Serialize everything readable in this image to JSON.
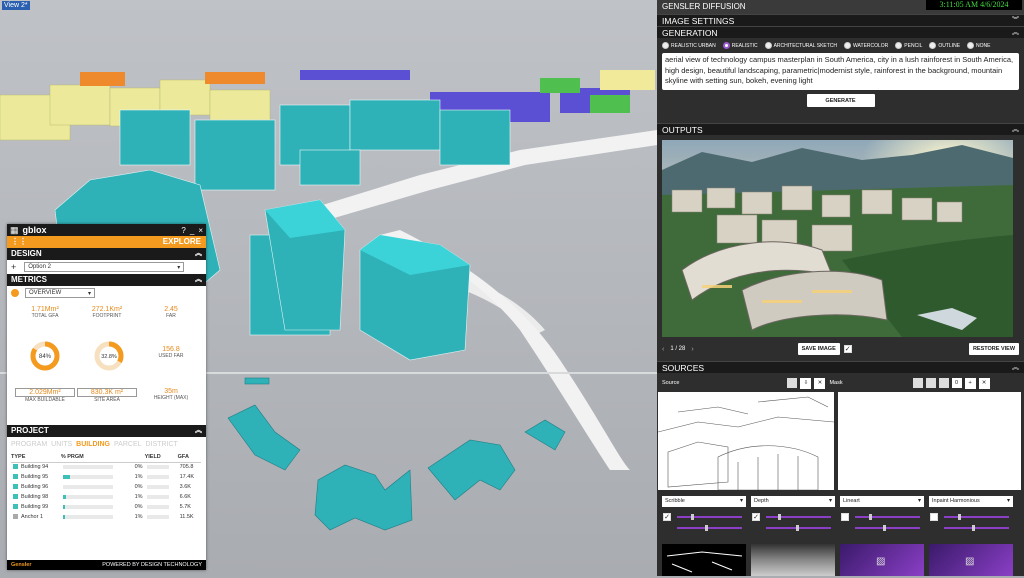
{
  "viewport": {
    "tab_label": "View 2*"
  },
  "gblox": {
    "logo": "gblox",
    "window_controls": [
      "?",
      "_",
      "×"
    ],
    "explore_label": "EXPLORE",
    "design_title": "DESIGN",
    "design_add": "+",
    "design_option": "Option 2",
    "metrics_title": "METRICS",
    "metrics_view": "OVERVIEW",
    "metrics": [
      {
        "value": "1.71Mm²",
        "label": "TOTAL GFA"
      },
      {
        "value": "272.1Km²",
        "label": "FOOTPRINT"
      },
      {
        "value": "2.45",
        "label": "FAR"
      },
      {
        "value": "84%",
        "label": ""
      },
      {
        "value": "32.8%",
        "label": ""
      },
      {
        "value": "156.8",
        "label": "USED FAR"
      },
      {
        "value": "2.029Mm²",
        "label": "MAX BUILDABLE"
      },
      {
        "value": "830.3K m²",
        "label": "SITE AREA"
      },
      {
        "value": "35m",
        "label": "HEIGHT (MAX)"
      }
    ],
    "donut1_pct": 84,
    "donut2_pct": 32.8,
    "project_title": "PROJECT",
    "project_tabs": [
      "PROGRAM",
      "UNITS",
      "BUILDING",
      "PARCEL",
      "DISTRICT"
    ],
    "project_active_tab": "BUILDING",
    "table_headers": [
      "TYPE",
      "% PRGM",
      "YIELD",
      "GFA"
    ],
    "rows": [
      {
        "name": "Building 94",
        "pct": "0%",
        "bar": 0,
        "gfa": "705.8",
        "color": "#3cc0b8"
      },
      {
        "name": "Building 95",
        "pct": "1%",
        "bar": 14,
        "gfa": "17.4K",
        "color": "#3cc0b8"
      },
      {
        "name": "Building 96",
        "pct": "0%",
        "bar": 0,
        "gfa": "3.6K",
        "color": "#3cc0b8"
      },
      {
        "name": "Building 98",
        "pct": "1%",
        "bar": 6,
        "gfa": "6.6K",
        "color": "#3cc0b8"
      },
      {
        "name": "Building 99",
        "pct": "0%",
        "bar": 4,
        "gfa": "5.7K",
        "color": "#3cc0b8"
      },
      {
        "name": "Anchor 1",
        "pct": "1%",
        "bar": 4,
        "gfa": "11.5K",
        "color": "#aaaaaa"
      }
    ],
    "footer_brand": "Gensler",
    "footer_powered": "POWERED BY DESIGN TECHNOLOGY"
  },
  "panel": {
    "title": "GENSLER DIFFUSION",
    "clock": "3:11:05 AM 4/6/2024",
    "image_settings": "IMAGE SETTINGS",
    "generation": "GENERATION",
    "styles": [
      "REALISTIC URBAN",
      "REALISTIC",
      "ARCHITECTURAL SKETCH",
      "WATERCOLOR",
      "PENCIL",
      "OUTLINE",
      "NONE"
    ],
    "selected_style": "REALISTIC",
    "prompt": "aerial view of technology campus masterplan in South America, city in a lush rainforest in South America, high design, beautiful landscaping, parametric|modernist style, rainforest in the background, mountain skyline with setting sun, bokeh, evening light",
    "generate": "GENERATE",
    "outputs": "OUTPUTS",
    "pager": "1 / 28",
    "save_image": "SAVE IMAGE",
    "restore_view": "RESTORE VIEW",
    "sources": "SOURCES",
    "source_label": "Source",
    "mask_label": "Mask",
    "mask_count": "0",
    "controlnets": [
      "Scribble",
      "Depth",
      "Lineart",
      "Inpaint Harmonious"
    ],
    "checked": [
      true,
      true,
      false,
      false
    ]
  }
}
